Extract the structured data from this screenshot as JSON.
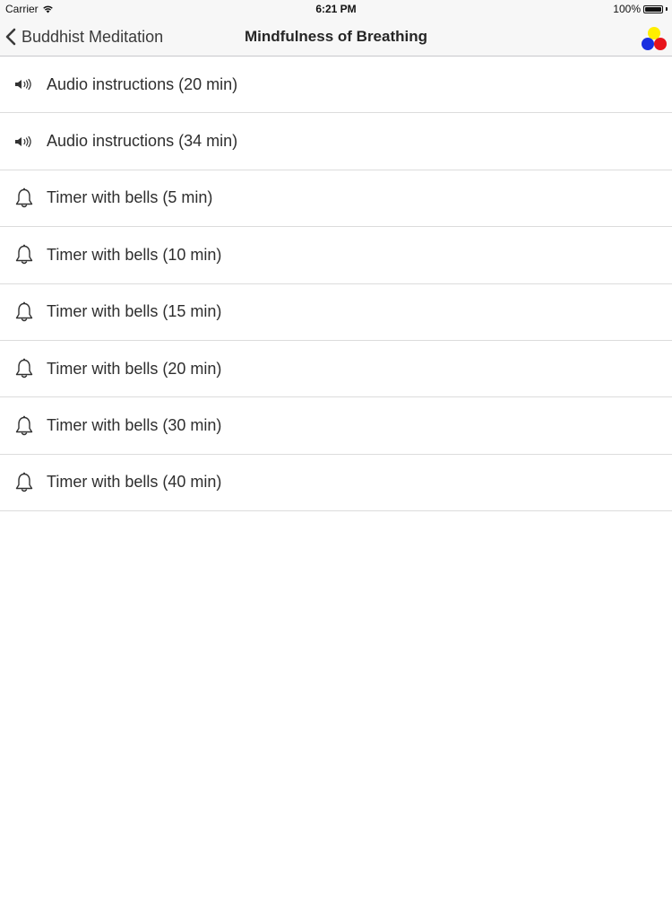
{
  "status_bar": {
    "carrier": "Carrier",
    "time": "6:21 PM",
    "battery": "100%",
    "battery_level": 1.0
  },
  "nav": {
    "back_label": "Buddhist Meditation",
    "title": "Mindfulness of Breathing",
    "logo_colors": {
      "top": "#ffee00",
      "bottom_left": "#1a2fe0",
      "bottom_right": "#e8141c"
    }
  },
  "items": [
    {
      "icon": "speaker-icon",
      "label": "Audio instructions (20 min)"
    },
    {
      "icon": "speaker-icon",
      "label": "Audio instructions (34 min)"
    },
    {
      "icon": "bell-icon",
      "label": "Timer with bells (5 min)"
    },
    {
      "icon": "bell-icon",
      "label": "Timer with bells (10 min)"
    },
    {
      "icon": "bell-icon",
      "label": "Timer with bells (15 min)"
    },
    {
      "icon": "bell-icon",
      "label": "Timer with bells (20 min)"
    },
    {
      "icon": "bell-icon",
      "label": "Timer with bells (30 min)"
    },
    {
      "icon": "bell-icon",
      "label": "Timer with bells (40 min)"
    }
  ]
}
